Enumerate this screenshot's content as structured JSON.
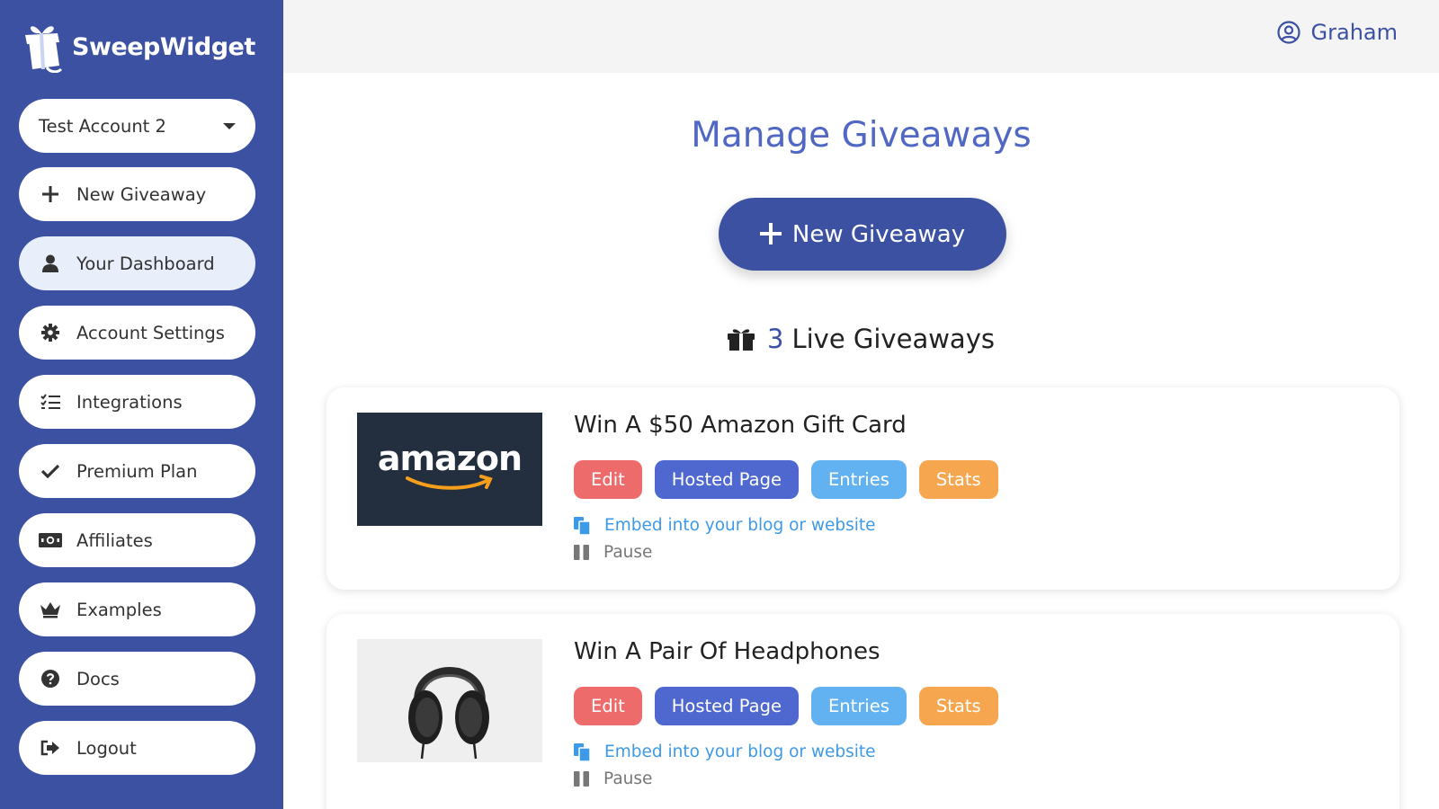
{
  "app": {
    "name": "SweepWidget"
  },
  "sidebar": {
    "account_selector": "Test Account 2",
    "items": [
      {
        "label": "New Giveaway",
        "icon": "plus-icon"
      },
      {
        "label": "Your Dashboard",
        "icon": "user-icon"
      },
      {
        "label": "Account Settings",
        "icon": "gear-icon"
      },
      {
        "label": "Integrations",
        "icon": "list-check-icon"
      },
      {
        "label": "Premium Plan",
        "icon": "check-icon"
      },
      {
        "label": "Affiliates",
        "icon": "money-icon"
      },
      {
        "label": "Examples",
        "icon": "crown-icon"
      },
      {
        "label": "Docs",
        "icon": "question-icon"
      },
      {
        "label": "Logout",
        "icon": "logout-icon"
      }
    ]
  },
  "header": {
    "user_name": "Graham"
  },
  "main": {
    "title": "Manage Giveaways",
    "new_button": "New Giveaway",
    "live_count": "3",
    "live_label": "Live Giveaways",
    "giveaways": [
      {
        "title": "Win A $50 Amazon Gift Card",
        "image_text": "amazon",
        "actions": [
          "Edit",
          "Hosted Page",
          "Entries",
          "Stats"
        ],
        "embed": "Embed into your blog or website",
        "pause": "Pause"
      },
      {
        "title": "Win A Pair Of Headphones",
        "actions": [
          "Edit",
          "Hosted Page",
          "Entries",
          "Stats"
        ],
        "embed": "Embed into your blog or website",
        "pause": "Pause"
      }
    ]
  },
  "colors": {
    "sidebar": "#3d51a3",
    "accent": "#5068c4",
    "edit": "#ee6b6b",
    "hosted": "#4f68cf",
    "entries": "#62b2f2",
    "stats": "#f5a64f"
  }
}
